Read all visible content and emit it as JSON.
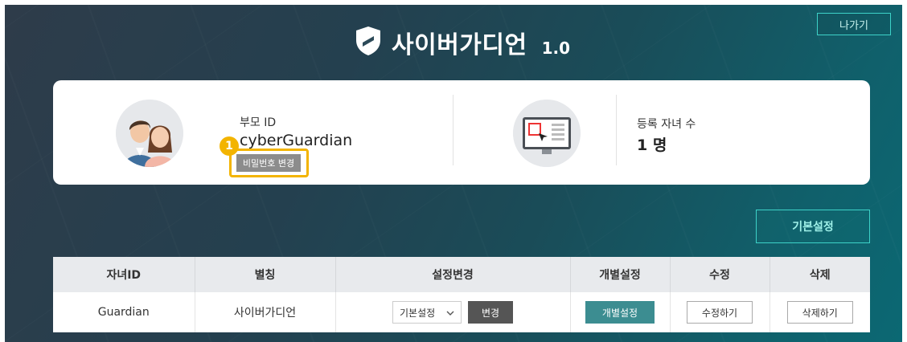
{
  "header": {
    "title": "사이버가디언",
    "version": "1.0",
    "exit_label": "나가기"
  },
  "profile": {
    "parent_id_label": "부모 ID",
    "parent_id_value": "cyberGuardian",
    "change_password_label": "비밀번호 변경",
    "marker_number": "1",
    "children_count_label": "등록 자녀 수",
    "children_count_value": "1 명"
  },
  "basic_settings_label": "기본설정",
  "table": {
    "headers": [
      "자녀ID",
      "별칭",
      "설정변경",
      "개별설정",
      "수정",
      "삭제"
    ],
    "rows": [
      {
        "child_id": "Guardian",
        "alias": "사이버가디언",
        "setting_select": "기본설정",
        "change_label": "변경",
        "individual_label": "개별설정",
        "edit_label": "수정하기",
        "delete_label": "삭제하기"
      }
    ]
  },
  "colors": {
    "accent": "#3dd2c8",
    "highlight": "#f3b400",
    "teal_button": "#3c8d91"
  }
}
